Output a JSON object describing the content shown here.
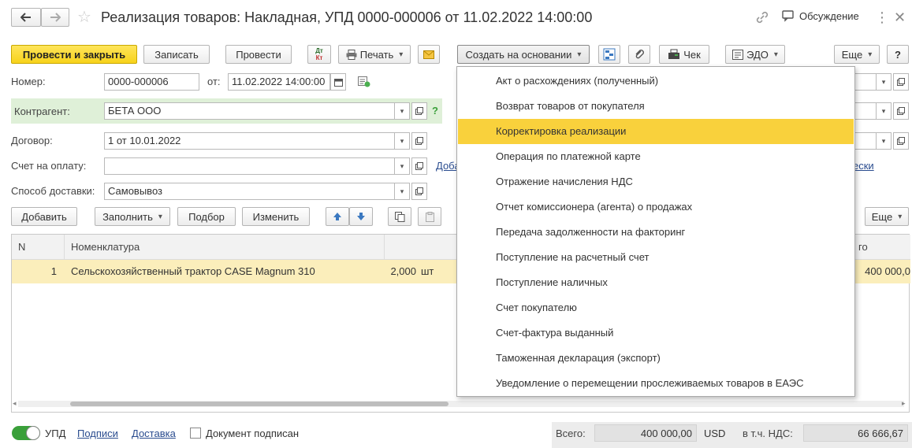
{
  "window": {
    "title": "Реализация товаров: Накладная, УПД 0000-000006 от 11.02.2022 14:00:00",
    "discussion_label": "Обсуждение"
  },
  "toolbar": {
    "post_close": "Провести и закрыть",
    "save": "Записать",
    "post": "Провести",
    "dt_kt_top": "Дт",
    "dt_kt_bottom": "Кт",
    "print": "Печать",
    "create_based": "Создать на основании",
    "receipt": "Чек",
    "edo": "ЭДО",
    "more": "Еще",
    "help": "?"
  },
  "form": {
    "number_label": "Номер:",
    "number_value": "0000-000006",
    "date_label": "от:",
    "date_value": "11.02.2022 14:00:00",
    "counterparty_label": "Контрагент:",
    "counterparty_value": "БЕТА ООО",
    "counterparty_help": "?",
    "contract_label": "Договор:",
    "contract_value": "1 от 10.01.2022",
    "invoice_label": "Счет на оплату:",
    "invoice_value": "",
    "invoice_link_partial": "Доба",
    "delivery_label": "Способ доставки:",
    "delivery_value": "Самовывоз",
    "right_link_partial": "ески"
  },
  "table_toolbar": {
    "add": "Добавить",
    "fill": "Заполнить",
    "pick": "Подбор",
    "change": "Изменить",
    "more": "Еще"
  },
  "table": {
    "headers": {
      "n": "N",
      "nomenclature": "Номенклатура",
      "total_partial": "го"
    },
    "rows": [
      {
        "n": "1",
        "nomenclature": "Сельскохозяйственный трактор CASE Magnum 310",
        "qty_partial": "2,000",
        "unit": "шт",
        "sum_partial": "400 000,0"
      }
    ]
  },
  "menu": {
    "items": [
      "Акт о расхождениях (полученный)",
      "Возврат товаров от покупателя",
      "Корректировка реализации",
      "Операция по платежной карте",
      "Отражение начисления НДС",
      "Отчет комиссионера (агента) о продажах",
      "Передача задолженности на факторинг",
      "Поступление на расчетный счет",
      "Поступление наличных",
      "Счет покупателю",
      "Счет-фактура выданный",
      "Таможенная декларация (экспорт)",
      "Уведомление о перемещении прослеживаемых товаров в ЕАЭС"
    ],
    "active_index": 2
  },
  "footer": {
    "upd_label": "УПД",
    "upd_toggle_on": true,
    "signatures_link": "Подписи",
    "delivery_link": "Доставка",
    "signed_label": "Документ подписан",
    "total_label": "Всего:",
    "total_value": "400 000,00",
    "currency": "USD",
    "vat_label": "в т.ч. НДС:",
    "vat_value": "66 666,67"
  },
  "colors": {
    "accent": "#f7d21b",
    "active_menu": "#f9d13c",
    "row_highlight": "#fbeebb",
    "link": "#2a4c8f",
    "toggle_green": "#3aa03a"
  }
}
